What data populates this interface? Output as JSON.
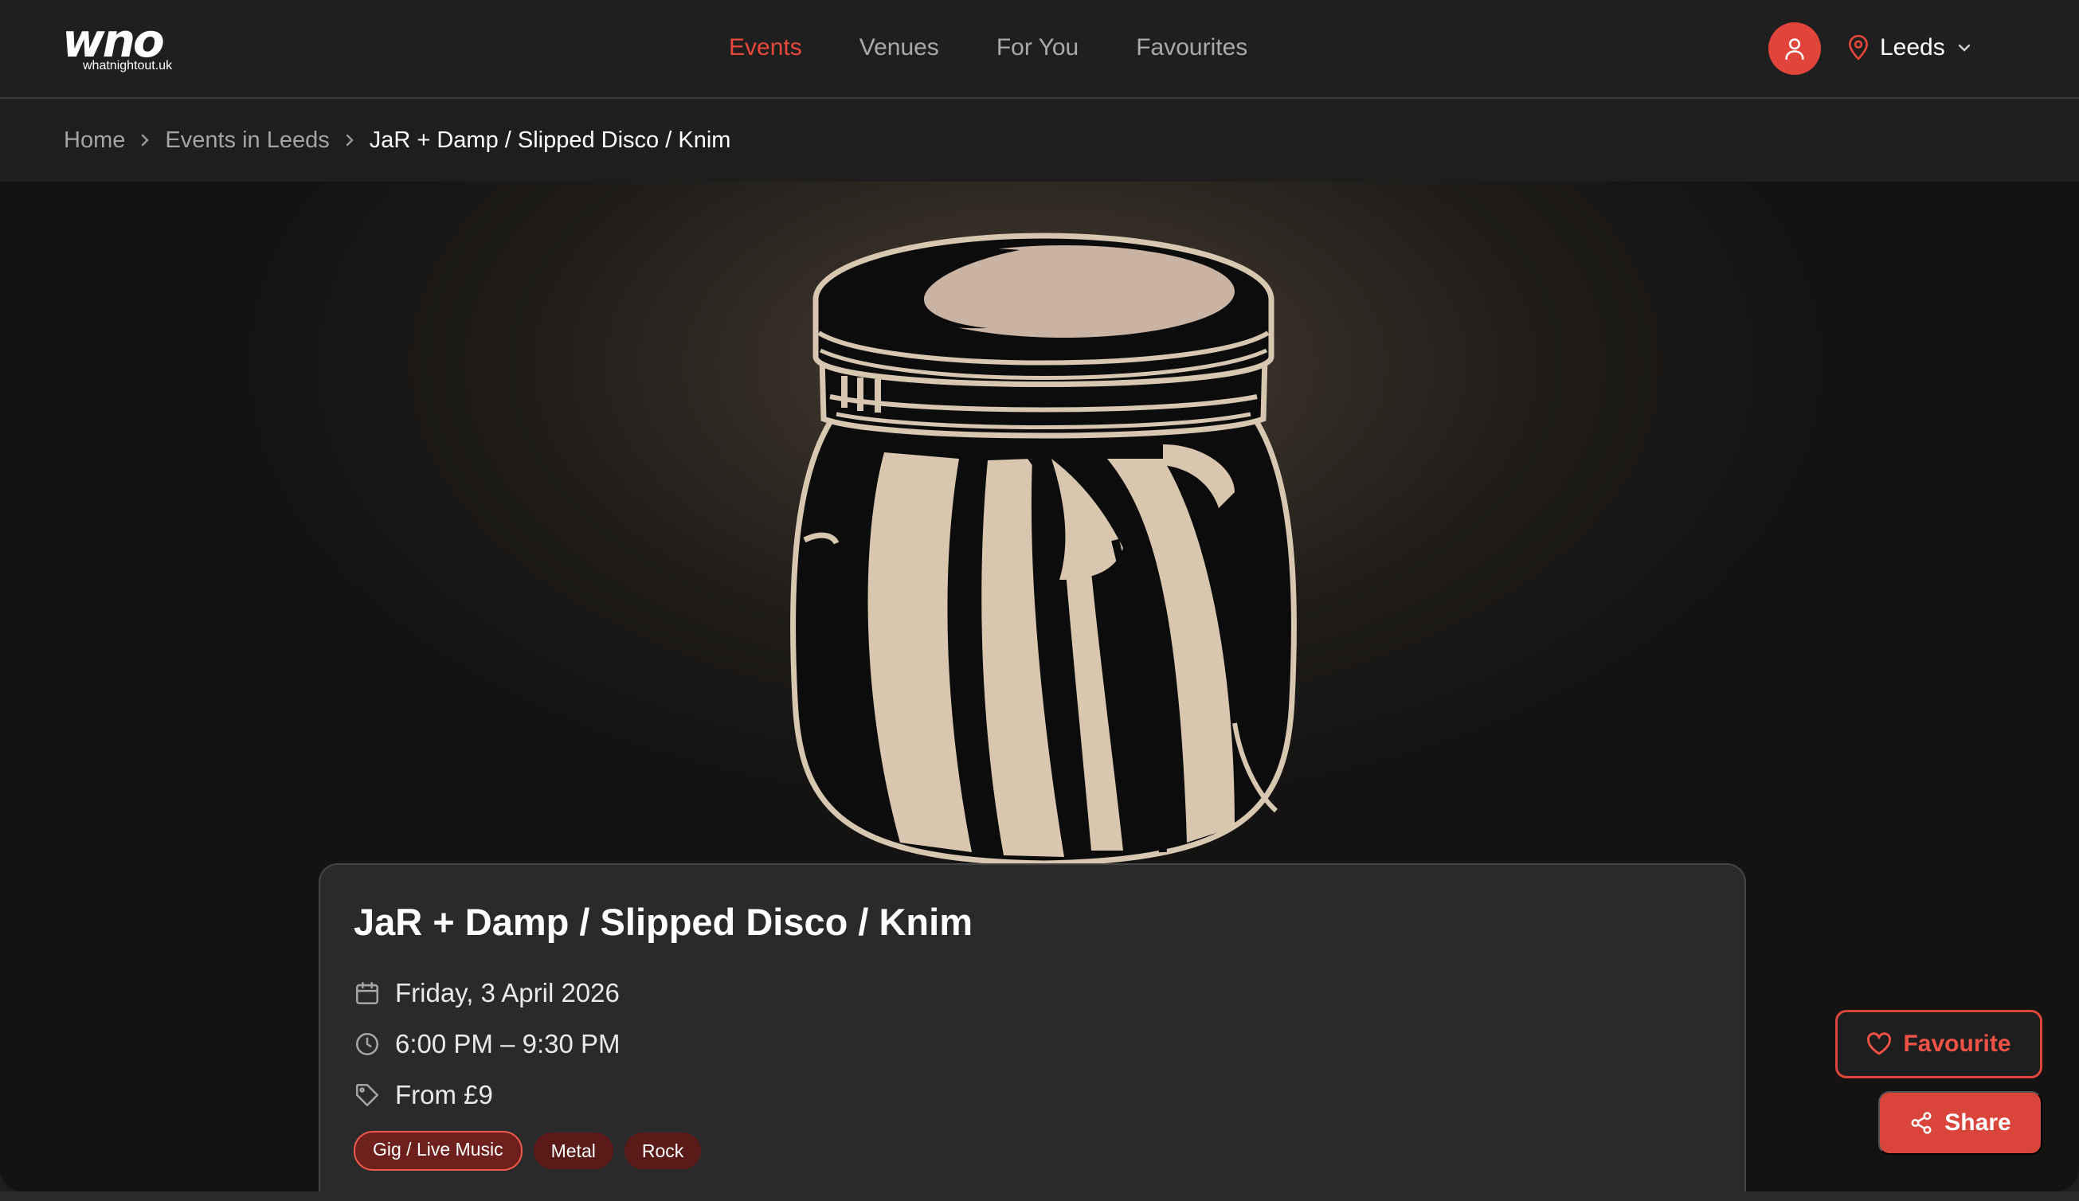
{
  "brand": {
    "logo_text": "wno",
    "logo_sub": "whatnightout.uk"
  },
  "nav": {
    "links": [
      {
        "label": "Events",
        "active": true
      },
      {
        "label": "Venues",
        "active": false
      },
      {
        "label": "For You",
        "active": false
      },
      {
        "label": "Favourites",
        "active": false
      }
    ],
    "location": "Leeds"
  },
  "breadcrumb": [
    "Home",
    "Events in Leeds",
    "JaR + Damp / Slipped Disco / Knim"
  ],
  "event": {
    "title": "JaR + Damp / Slipped Disco / Knim",
    "date": "Friday, 3 April 2026",
    "time": "6:00 PM – 9:30 PM",
    "price": "From £9",
    "tags": [
      "Gig / Live Music",
      "Metal",
      "Rock"
    ]
  },
  "actions": {
    "favourite": "Favourite",
    "share": "Share"
  },
  "colors": {
    "accent": "#e0443a",
    "background": "#1e1e1e",
    "card": "#2a2a2a"
  },
  "icons": {
    "user": "user-icon",
    "location": "map-pin-icon",
    "dropdown": "chevron-down-icon",
    "date": "calendar-icon",
    "time": "clock-icon",
    "price": "tag-icon",
    "favourite": "heart-icon",
    "share": "share-icon"
  }
}
